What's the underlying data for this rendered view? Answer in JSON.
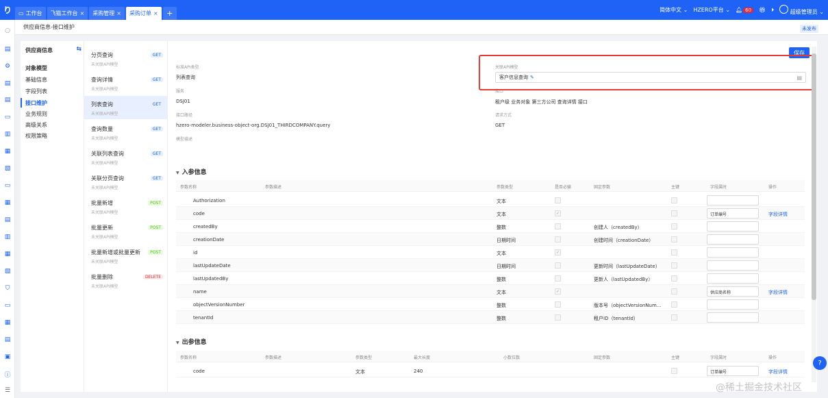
{
  "topbar": {
    "logo": "り",
    "tabs": [
      {
        "label": "工作台",
        "closable": false,
        "active": false,
        "icon": "monitor-icon"
      },
      {
        "label": "飞猫工作台",
        "closable": true,
        "active": false
      },
      {
        "label": "采购管理",
        "closable": true,
        "active": false
      },
      {
        "label": "采购订单",
        "closable": true,
        "active": true
      }
    ],
    "add_tab": "+",
    "close_glyph": "×",
    "language": "简体中文",
    "platform": "HZERO平台",
    "notify_count": "60",
    "user": "超级管理员"
  },
  "breadcrumb": "供应商信息-接口维护",
  "status_tag": "未发布",
  "model_nav": {
    "title": "供应商信息",
    "items": [
      "对象模型",
      "基础信息",
      "字段列表",
      "接口维护",
      "业务规则",
      "高级关系",
      "权限策略"
    ],
    "active_index": 3
  },
  "apis": [
    {
      "name": "分页查询",
      "sub": "未关联API模型",
      "method": "GET"
    },
    {
      "name": "查询详情",
      "sub": "未关联API模型",
      "method": "GET"
    },
    {
      "name": "列表查询",
      "sub": "未关联API模型",
      "method": "GET",
      "active": true
    },
    {
      "name": "查询数量",
      "sub": "未关联API模型",
      "method": "GET"
    },
    {
      "name": "关联列表查询",
      "sub": "未关联API模型",
      "method": "GET"
    },
    {
      "name": "关联分页查询",
      "sub": "未关联API模型",
      "method": "GET"
    },
    {
      "name": "批量新增",
      "sub": "未关联API模型",
      "method": "POST"
    },
    {
      "name": "批量更新",
      "sub": "未关联API模型",
      "method": "POST"
    },
    {
      "name": "批量新增或批量更新",
      "sub": "未关联API模型",
      "method": "POST"
    },
    {
      "name": "批量删除",
      "sub": "未关联API模型",
      "method": "DELETE"
    }
  ],
  "detail": {
    "save": "保存",
    "std_api_type_label": "标准API类型",
    "std_api_type": "列表查询",
    "rel_api_model_label": "关联API模型",
    "rel_api_model": "客户信息查询",
    "service_label": "服务",
    "service": "DSJ01",
    "api_desc_label": "接口",
    "api_desc": "租户级 业务对象 第三方公司 查询详情 接口",
    "path_label": "接口路径",
    "path": "hzero-modeler.business-object-org.DSJ01_THIRDCOMPANY.query",
    "method_label": "请求方式",
    "method": "GET",
    "remark_label": "模型描述"
  },
  "input_section": {
    "title": "入参信息",
    "headers": [
      "参数名称",
      "参数描述",
      "参数类型",
      "是否必输",
      "固定参数",
      "主键",
      "字段属时",
      "操作"
    ],
    "rows": [
      {
        "name": "Authorization",
        "type": "文本",
        "required": false,
        "fixed": "",
        "field": "",
        "op": ""
      },
      {
        "name": "code",
        "type": "文本",
        "required": true,
        "fixed": "",
        "field": "订单编号",
        "op": "字段详情"
      },
      {
        "name": "createdBy",
        "type": "整数",
        "required": false,
        "fixed": "创建人（createdBy）",
        "field": "",
        "op": ""
      },
      {
        "name": "creationDate",
        "type": "日期时间",
        "required": false,
        "fixed": "创建时间（creationDate）",
        "field": "",
        "op": ""
      },
      {
        "name": "id",
        "type": "文本",
        "required": true,
        "fixed": "",
        "field": "",
        "op": ""
      },
      {
        "name": "lastUpdateDate",
        "type": "日期时间",
        "required": false,
        "fixed": "更新时间（lastUpdateDate）",
        "field": "",
        "op": ""
      },
      {
        "name": "lastUpdatedBy",
        "type": "整数",
        "required": false,
        "fixed": "更新人（lastUpdatedBy）",
        "field": "",
        "op": ""
      },
      {
        "name": "name",
        "type": "文本",
        "required": true,
        "fixed": "",
        "field": "供应商名称",
        "op": "字段详情"
      },
      {
        "name": "objectVersionNumber",
        "type": "整数",
        "required": false,
        "fixed": "版本号（objectVersionNum...",
        "field": "",
        "op": ""
      },
      {
        "name": "tenantId",
        "type": "整数",
        "required": false,
        "fixed": "租户ID（tenantId）",
        "field": "",
        "op": ""
      }
    ]
  },
  "output_section": {
    "title": "出参信息",
    "headers": [
      "参数名称",
      "参数描述",
      "参数类型",
      "最大长度",
      "小数位数",
      "固定参数",
      "主键",
      "字段属时",
      "操作"
    ],
    "rows": [
      {
        "name": "code",
        "type": "文本",
        "max_len": "240",
        "field": "订单编号",
        "op": "字段详情"
      }
    ]
  },
  "help": "?",
  "watermark": "@稀土掘金技术社区",
  "colors": {
    "primary": "#1e63f5",
    "highlight": "#e53935",
    "post": "#52c41a",
    "delete": "#f5222d"
  }
}
